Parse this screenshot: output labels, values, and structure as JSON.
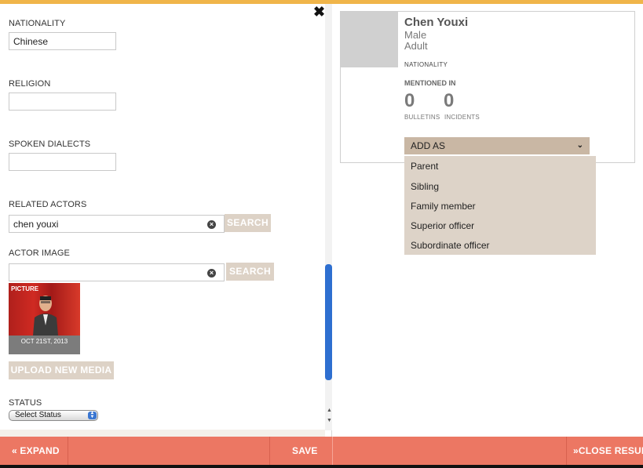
{
  "form": {
    "nationality": {
      "label": "NATIONALITY",
      "value": "Chinese"
    },
    "religion": {
      "label": "RELIGION",
      "value": ""
    },
    "spoken_dialects": {
      "label": "SPOKEN DIALECTS",
      "value": ""
    },
    "related_actors": {
      "label": "RELATED ACTORS",
      "value": "chen youxi",
      "search_label": "SEARCH"
    },
    "actor_image": {
      "label": "ACTOR IMAGE",
      "value": "",
      "search_label": "SEARCH"
    },
    "media": {
      "type_label": "PICTURE",
      "date": "OCT 21ST, 2013"
    },
    "upload_label": "UPLOAD NEW MEDIA",
    "status": {
      "label": "STATUS",
      "selected": "Select Status"
    },
    "close_symbol": "✖"
  },
  "bottom_bar": {
    "expand_label": "« EXPAND",
    "save_label": "SAVE",
    "close_results_label": "»CLOSE RESULTS"
  },
  "actor_card": {
    "name": "Chen Youxi",
    "sex": "Male",
    "age": "Adult",
    "nationality_label": "NATIONALITY",
    "mentioned_in_label": "MENTIONED IN",
    "bulletins_count": "0",
    "bulletins_label": "BULLETINS",
    "incidents_count": "0",
    "incidents_label": "INCIDENTS",
    "add_as_label": "ADD AS",
    "relation_options": [
      "Parent",
      "Sibling",
      "Family member",
      "Superior officer",
      "Subordinate officer"
    ]
  },
  "colors": {
    "accent_top": "#f0b54a",
    "bottom_bar": "#ec7763",
    "button_beige": "#ddd2c6",
    "dropdown_beige": "#ddd3c8",
    "add_as_bg": "#c9b7a4",
    "scroll_thumb": "#2e6fd0"
  }
}
